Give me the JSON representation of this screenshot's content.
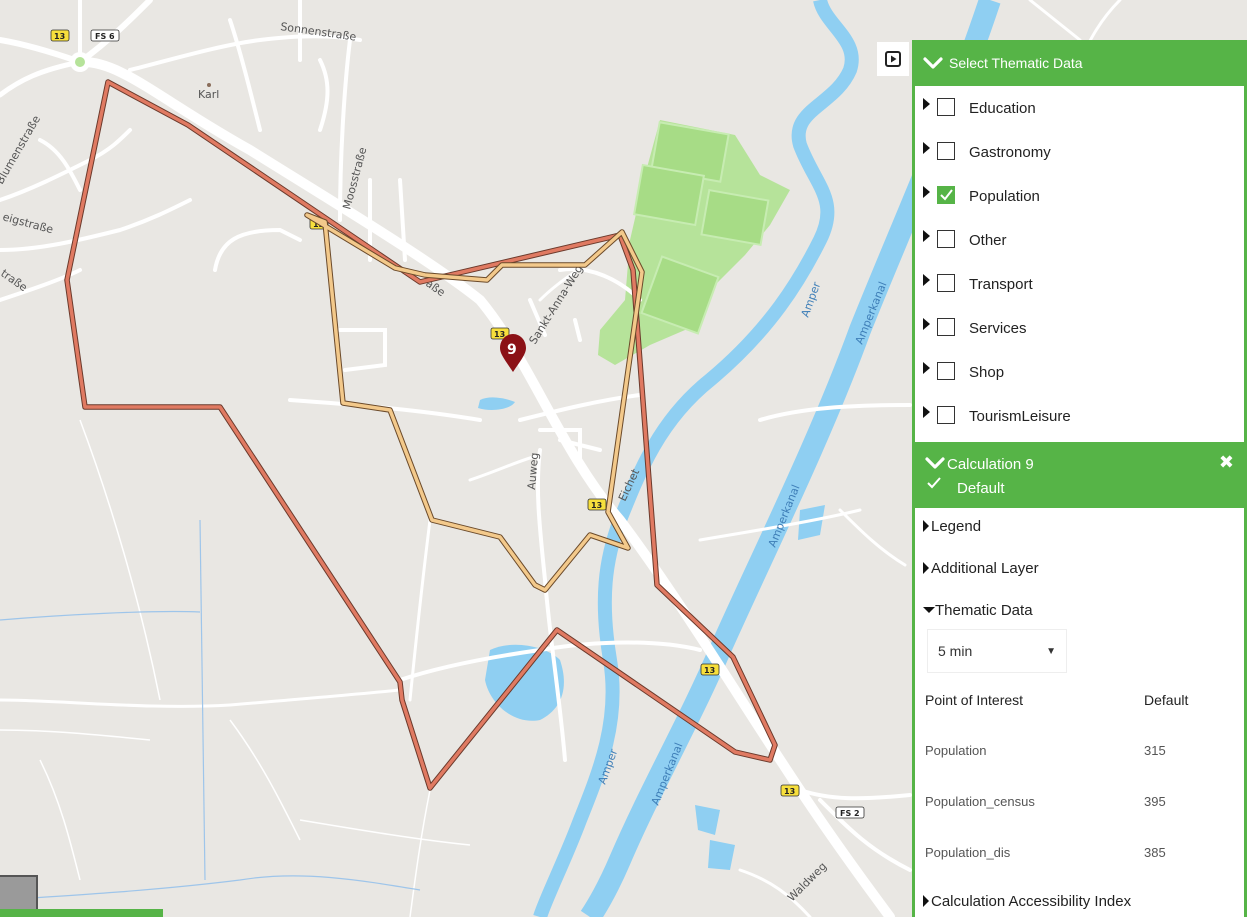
{
  "map": {
    "place_labels": {
      "karl": "Karl",
      "sonnenstrasse": "Sonnenstraße",
      "blumenstrasse": "Blumenstraße",
      "eigstrasse": "eigstraße",
      "strasse_left": "traße",
      "moosstrasse": "Moosstraße",
      "strasse_main": "aße",
      "sankt_anna_weg": "Sankt-Anna-Weg",
      "auweg": "Auweg",
      "eichet": "Eichet",
      "amper_1": "Amper",
      "amper_2": "Amper",
      "amperkanal_1": "Amperkanal",
      "amperkanal_2": "Amperkanal",
      "amperkanal_3": "Amperkanal",
      "waldweg": "Waldweg"
    },
    "road_shields": [
      "13",
      "FS 6",
      "13",
      "13",
      "13",
      "13",
      "FS 2",
      "13"
    ],
    "marker_label": "9",
    "colors": {
      "isochrone_outer": "#e07a62",
      "isochrone_inner": "#f3c98b",
      "marker": "#8b1116",
      "water": "#8fcff2",
      "park": "#b6e39a"
    }
  },
  "controls": {
    "play_icon": "play-icon"
  },
  "thematic": {
    "title": "Select Thematic Data",
    "categories": [
      {
        "label": "Education",
        "checked": false
      },
      {
        "label": "Gastronomy",
        "checked": false
      },
      {
        "label": "Population",
        "checked": true
      },
      {
        "label": "Other",
        "checked": false
      },
      {
        "label": "Transport",
        "checked": false
      },
      {
        "label": "Services",
        "checked": false
      },
      {
        "label": "Shop",
        "checked": false
      },
      {
        "label": "TourismLeisure",
        "checked": false
      }
    ]
  },
  "calculation": {
    "title": "Calculation 9",
    "scenario": "Default",
    "close_icon": "close-icon",
    "sections": {
      "legend": "Legend",
      "additional_layer": "Additional Layer",
      "thematic_data": "Thematic Data",
      "accessibility": "Calculation Accessibility Index"
    },
    "time_select": {
      "value": "5 min"
    },
    "table": {
      "headers": [
        "Point of Interest",
        "Default"
      ],
      "rows": [
        [
          "Population",
          "315"
        ],
        [
          "Population_census",
          "395"
        ],
        [
          "Population_dis",
          "385"
        ]
      ]
    }
  }
}
